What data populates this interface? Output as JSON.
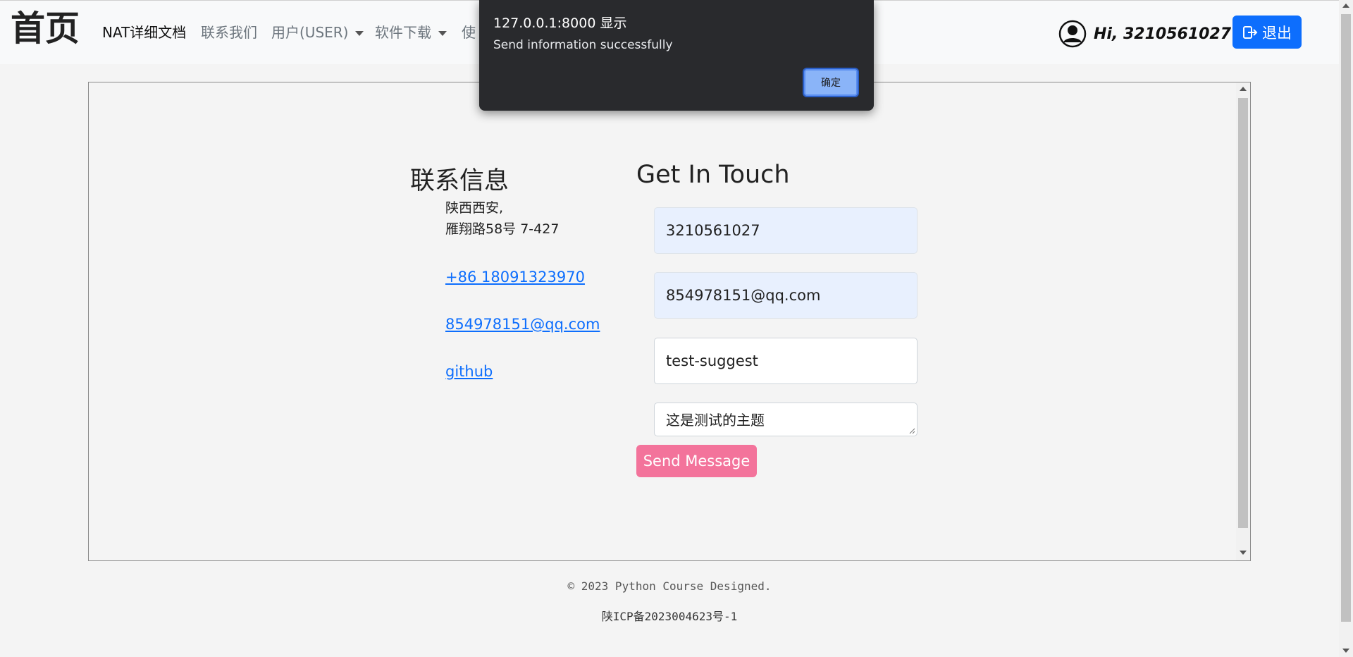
{
  "navbar": {
    "brand": "首页",
    "items": [
      {
        "label": "NAT详细文档"
      },
      {
        "label": "联系我们"
      },
      {
        "label": "用户(USER)"
      },
      {
        "label": "软件下载"
      },
      {
        "label": "使"
      }
    ],
    "user_greeting": "Hi, 3210561027",
    "logout_label": "退出"
  },
  "contact": {
    "heading": "联系信息",
    "address_line1": "陕西西安,",
    "address_line2": "雁翔路58号 7-427",
    "phone": "+86 18091323970",
    "email": "854978151@qq.com",
    "github": "github"
  },
  "form": {
    "heading": "Get In Touch",
    "name_value": "3210561027",
    "email_value": "854978151@qq.com",
    "subject_value": "test-suggest",
    "message_value": "这是测试的主题",
    "send_label": "Send Message"
  },
  "footer": {
    "copyright": "© 2023 Python Course Designed.",
    "icp": "陕ICP备2023004623号-1"
  },
  "alert": {
    "title": "127.0.0.1:8000 显示",
    "message": "Send information successfully",
    "ok_label": "确定"
  },
  "colors": {
    "primary": "#0d6efd",
    "send_button": "#f3739b",
    "alert_bg": "#292a2d",
    "autofill_bg": "#e8f0fe"
  }
}
